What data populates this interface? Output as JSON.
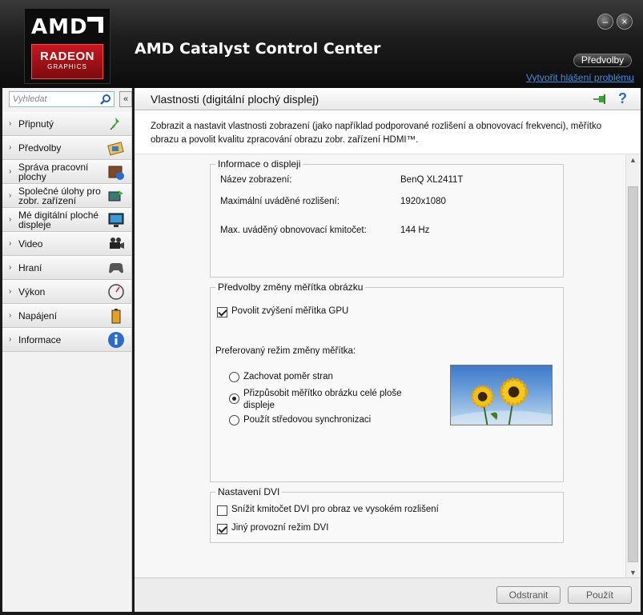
{
  "header": {
    "logo_amd": "AMD",
    "logo_radeon": "RADEON",
    "logo_graphics": "GRAPHICS",
    "title": "AMD Catalyst Control Center",
    "minimize": "–",
    "close": "×",
    "preferences_button": "Předvolby",
    "report_link": "Vytvořit hlášení problému"
  },
  "sidebar": {
    "search_placeholder": "Vyhledat",
    "collapse": "«",
    "items": [
      {
        "label": "Připnutý",
        "icon": "pin-icon"
      },
      {
        "label": "Předvolby",
        "icon": "preferences-icon"
      },
      {
        "label": "Správa pracovní plochy",
        "icon": "desktop-icon"
      },
      {
        "label": "Společné úlohy pro zobr. zařízení",
        "icon": "display-tasks-icon"
      },
      {
        "label": "Mé digitální ploché displeje",
        "icon": "monitor-icon"
      },
      {
        "label": "Video",
        "icon": "camera-icon"
      },
      {
        "label": "Hraní",
        "icon": "gamepad-icon"
      },
      {
        "label": "Výkon",
        "icon": "gauge-icon"
      },
      {
        "label": "Napájení",
        "icon": "battery-icon"
      },
      {
        "label": "Informace",
        "icon": "info-icon"
      }
    ]
  },
  "main": {
    "title": "Vlastnosti (digitální plochý displej)",
    "help": "?",
    "description": "Zobrazit a nastavit vlastnosti zobrazení (jako například podporované rozlišení a obnovovací frekvenci), měřítko obrazu a povolit kvalitu zpracování obrazu zobr. zařízení HDMI™.",
    "display_info": {
      "title": "Informace o displeji",
      "name_label": "Název zobrazení:",
      "name_value": "BenQ XL2411T",
      "resolution_label": "Maximální uváděné rozlišení:",
      "resolution_value": "1920x1080",
      "refresh_label": "Max. uváděný obnovovací kmitočet:",
      "refresh_value": "144 Hz"
    },
    "scaling": {
      "title": "Předvolby změny měřítka obrázku",
      "gpu_scaling_label": "Povolit zvýšení měřítka GPU",
      "gpu_scaling_checked": true,
      "mode_label": "Preferovaný režim změny měřítka:",
      "options": [
        {
          "label": "Zachovat poměr stran",
          "selected": false
        },
        {
          "label": "Přizpůsobit měřítko obrázku celé ploše displeje",
          "selected": true
        },
        {
          "label": "Použít středovou synchronizaci",
          "selected": false
        }
      ]
    },
    "dvi": {
      "title": "Nastavení DVI",
      "reduce_label": "Snížit kmitočet DVI pro obraz ve vysokém rozlišení",
      "reduce_checked": false,
      "alt_mode_label": "Jiný provozní režim DVI",
      "alt_mode_checked": true
    }
  },
  "footer": {
    "remove_button": "Odstranit",
    "apply_button": "Použít"
  }
}
